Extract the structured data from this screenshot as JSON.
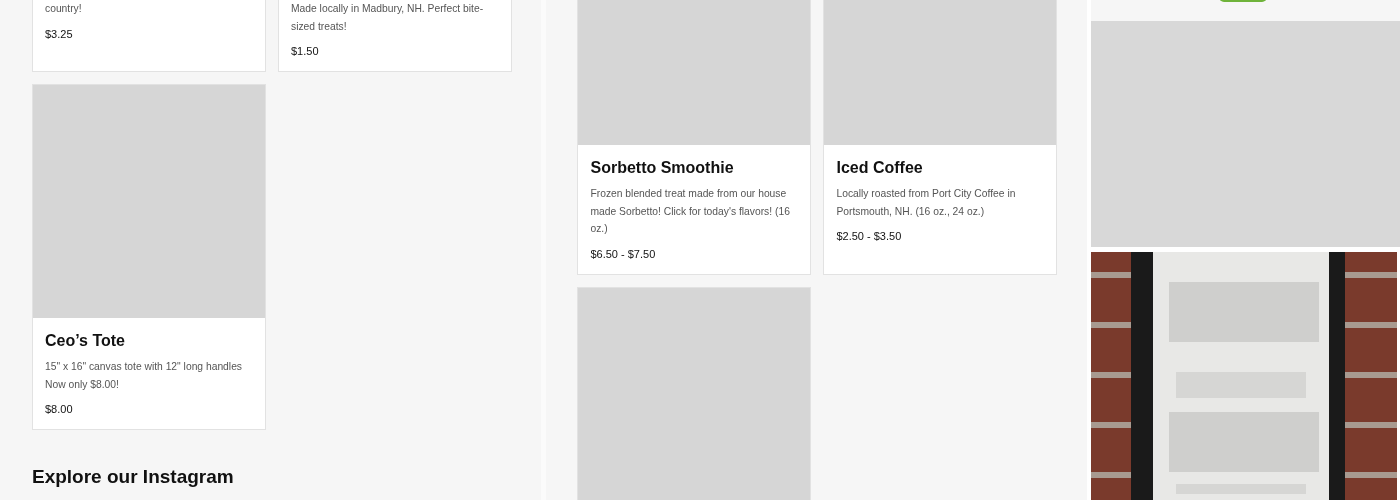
{
  "left_column": {
    "products": [
      {
        "image_placeholder": false,
        "description": "country!",
        "price": "$3.25"
      },
      {
        "image_placeholder": false,
        "description": "Made locally in Madbury, NH. Perfect bite-sized treats!",
        "price": "$1.50"
      },
      {
        "image_placeholder": true,
        "title": "Ceo’s Tote",
        "description": "15\" x 16\" canvas tote with 12\" long handles\nNow only $8.00!",
        "price": "$8.00"
      }
    ],
    "section_heading": "Explore our Instagram"
  },
  "middle_column": {
    "products": [
      {
        "image_placeholder": true,
        "title": "Sorbetto Smoothie",
        "description": "Frozen blended treat made from our house made Sorbetto! Click for today's flavors! (16 oz.)",
        "price": "$6.50 - $7.50"
      },
      {
        "image_placeholder": true,
        "title": "Iced Coffee",
        "description": "Locally roasted from Port City Coffee in Portsmouth, NH. (16 oz., 24 oz.)",
        "price": "$2.50 - $3.50"
      },
      {
        "image_placeholder": true
      }
    ]
  },
  "right_column": {
    "items": [
      {
        "kind": "button"
      },
      {
        "kind": "placeholder"
      },
      {
        "kind": "picture"
      }
    ]
  }
}
